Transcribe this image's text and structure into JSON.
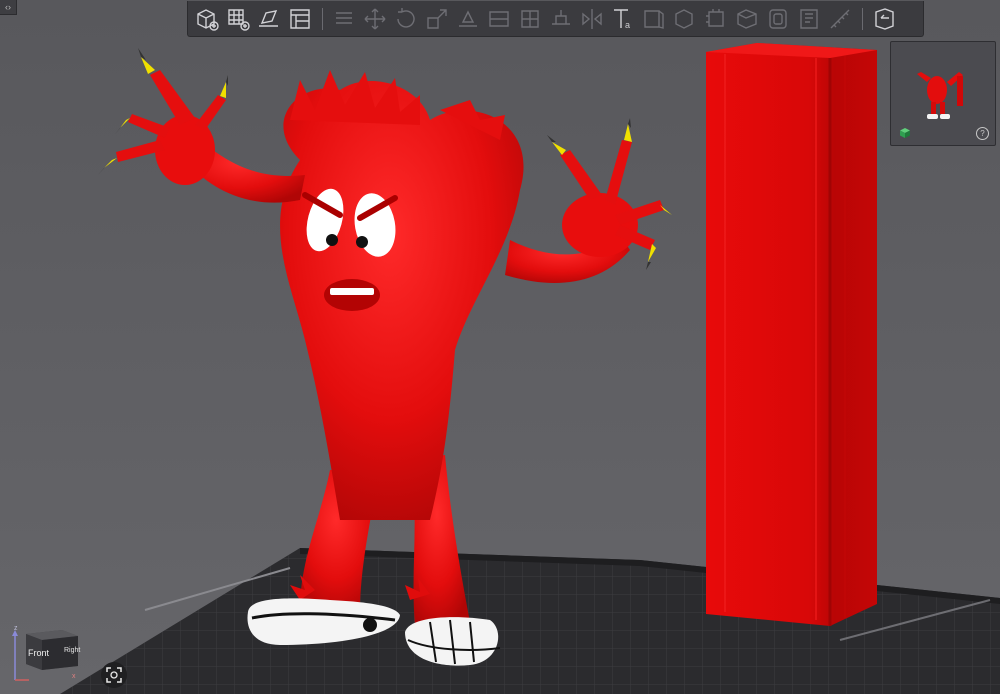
{
  "toolbar": {
    "buttons": [
      {
        "icon": "add-object-icon",
        "enabled": true
      },
      {
        "icon": "arrange-grid-icon",
        "enabled": true
      },
      {
        "icon": "lay-on-face-icon",
        "enabled": true
      },
      {
        "icon": "plate-layout-icon",
        "enabled": true
      },
      {
        "icon": "menu-lines-icon",
        "enabled": false
      },
      {
        "icon": "move-icon",
        "enabled": false
      },
      {
        "icon": "rotate-icon",
        "enabled": false
      },
      {
        "icon": "scale-icon",
        "enabled": false
      },
      {
        "icon": "place-on-face-icon",
        "enabled": false
      },
      {
        "icon": "cut-icon",
        "enabled": false
      },
      {
        "icon": "split-icon",
        "enabled": false
      },
      {
        "icon": "support-paint-icon",
        "enabled": false
      },
      {
        "icon": "mirror-icon",
        "enabled": false
      },
      {
        "icon": "text-icon",
        "enabled": true
      },
      {
        "icon": "object-list-icon",
        "enabled": false
      },
      {
        "icon": "modifier-icon",
        "enabled": false
      },
      {
        "icon": "seam-paint-icon",
        "enabled": false
      },
      {
        "icon": "negative-volume-icon",
        "enabled": false
      },
      {
        "icon": "hollow-icon",
        "enabled": false
      },
      {
        "icon": "variable-layer-icon",
        "enabled": false
      },
      {
        "icon": "measure-icon",
        "enabled": false
      },
      {
        "icon": "assembly-view-icon",
        "enabled": true
      }
    ]
  },
  "view_cube": {
    "face_label": "Front",
    "side_label": "Right",
    "axis_z": "z",
    "axis_x": "x"
  },
  "thumbnail": {
    "help_label": "?"
  },
  "colors": {
    "background": "#5d5d61",
    "model_red": "#e30d0d",
    "tower_red": "#d80808",
    "bed": "#2a2a2d",
    "toolbar": "#3b3b3f"
  }
}
